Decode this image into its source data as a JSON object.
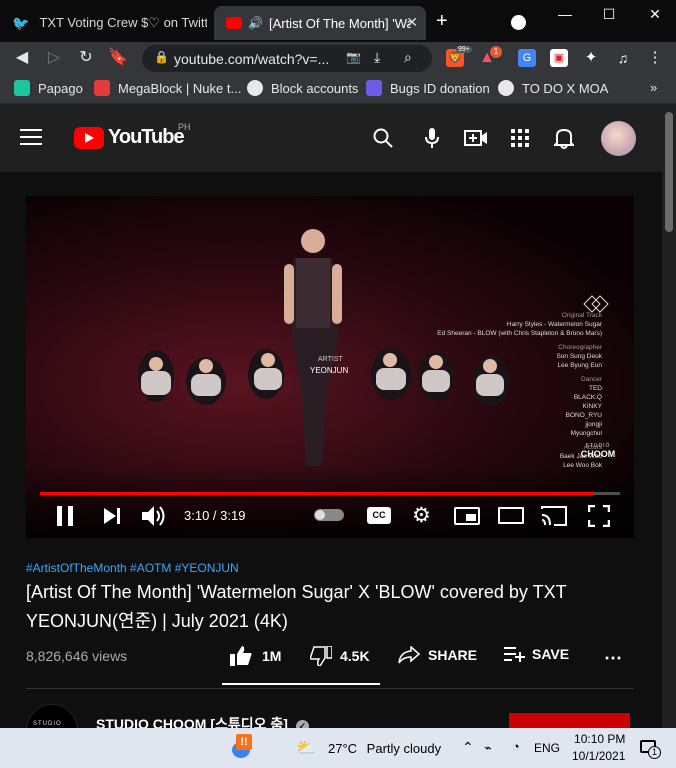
{
  "browser": {
    "tabs": [
      {
        "title": "TXT Voting Crew $♡ on Twitter: \"",
        "active": false
      },
      {
        "title": "[Artist Of The Month] 'Wa",
        "active": true
      }
    ],
    "new_tab": "+",
    "url": "youtube.com/watch?v=...",
    "extension_badges": {
      "brave": "99+",
      "alert": "1"
    },
    "bookmarks": [
      {
        "label": "Papago",
        "icon": "papago-icon",
        "color": "#1ec6a0"
      },
      {
        "label": "MegaBlock | Nuke t...",
        "icon": "megablock-icon",
        "color": "#e23c3c"
      },
      {
        "label": "Block accounts",
        "icon": "globe-icon",
        "color": "#e8e8e8"
      },
      {
        "label": "Bugs ID donation",
        "icon": "list-icon",
        "color": "#6c5ce7"
      },
      {
        "label": "TO DO X MOA",
        "icon": "globe-icon",
        "color": "#e8e8e8"
      }
    ]
  },
  "youtube": {
    "logo_text": "YouTube",
    "country": "PH",
    "video": {
      "overlay_artist_label": "ARTIST",
      "overlay_artist_name": "YEONJUN",
      "credits": [
        {
          "text": "Original Track",
          "head": true
        },
        {
          "text": "Harry Styles - Watermelon Sugar",
          "head": false
        },
        {
          "text": "Ed Sheeran - BLOW (with Chris Stapleton & Bruno Mars)",
          "head": false
        },
        {
          "text": "Choreographer",
          "head": true
        },
        {
          "text": "Son Sung Deuk",
          "head": false
        },
        {
          "text": "Lee Byung Eun",
          "head": false
        },
        {
          "text": "Dancer",
          "head": true
        },
        {
          "text": "TED",
          "head": false
        },
        {
          "text": "BLACK.Q",
          "head": false
        },
        {
          "text": "KINKY",
          "head": false
        },
        {
          "text": "BONO_RYU",
          "head": false
        },
        {
          "text": "jjongji",
          "head": false
        },
        {
          "text": "Myungchul",
          "head": false
        },
        {
          "text": "Actors",
          "head": true
        },
        {
          "text": "Baek Jae Woo",
          "head": false
        },
        {
          "text": "Lee Woo Bok",
          "head": false
        }
      ],
      "watermark_top": "STUDIO",
      "watermark_bottom": "CHOOM",
      "current_time": "3:10",
      "duration": "3:19",
      "time_display": "3:10 / 3:19",
      "progress_fraction": 0.955
    },
    "hashtags": "#ArtistOfTheMonth #AOTM #YEONJUN",
    "title": "[Artist Of The Month] 'Watermelon Sugar' X 'BLOW' covered by TXT YEONJUN(연준) | July 2021 (4K)",
    "views": "8,826,646 views",
    "actions": {
      "like": "1M",
      "dislike": "4.5K",
      "share": "SHARE",
      "save": "SAVE"
    },
    "channel": {
      "name": "STUDIO CHOOM [스튜디오 춤]",
      "avatar_text": "STUDIO"
    }
  },
  "taskbar": {
    "temperature": "27°C",
    "weather": "Partly cloudy",
    "language": "ENG",
    "time": "10:10 PM",
    "date": "10/1/2021",
    "notification_count": "1"
  }
}
